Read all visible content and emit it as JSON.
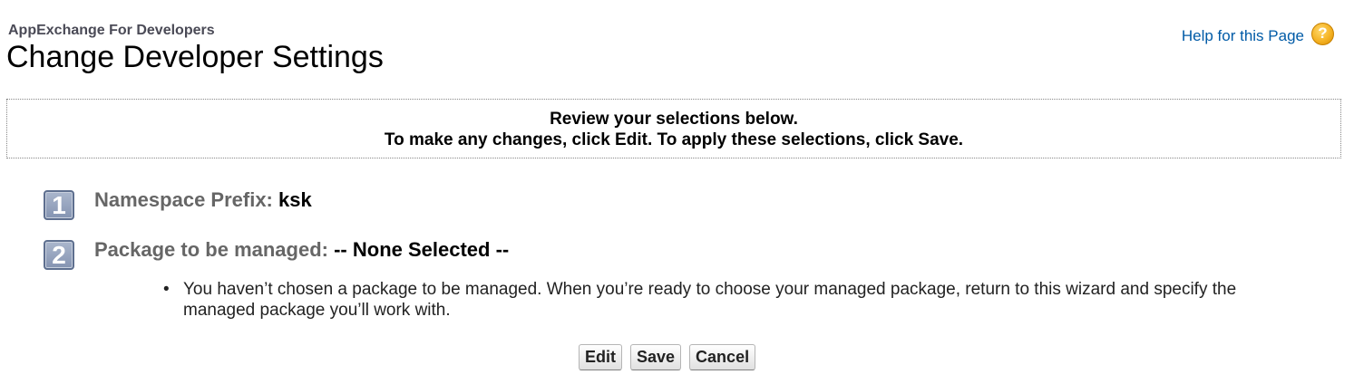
{
  "header": {
    "subtitle": "AppExchange For Developers",
    "title": "Change Developer Settings",
    "help_link": "Help for this Page",
    "help_icon": "?"
  },
  "review": {
    "line1": "Review your selections below.",
    "line2": "To make any changes, click Edit. To apply these selections, click Save."
  },
  "steps": [
    {
      "number": "1",
      "label": "Namespace Prefix:",
      "value": "ksk"
    },
    {
      "number": "2",
      "label": "Package to be managed:",
      "value": "-- None Selected --"
    }
  ],
  "note": {
    "bullet": "•",
    "text": "You haven’t chosen a package to be managed. When you’re ready to choose your managed package, return to this wizard and specify the managed package you’ll work with."
  },
  "buttons": {
    "edit": "Edit",
    "save": "Save",
    "cancel": "Cancel"
  },
  "colors": {
    "link": "#015ba7",
    "step_badge": "#8594b2",
    "label_gray": "#666666"
  }
}
